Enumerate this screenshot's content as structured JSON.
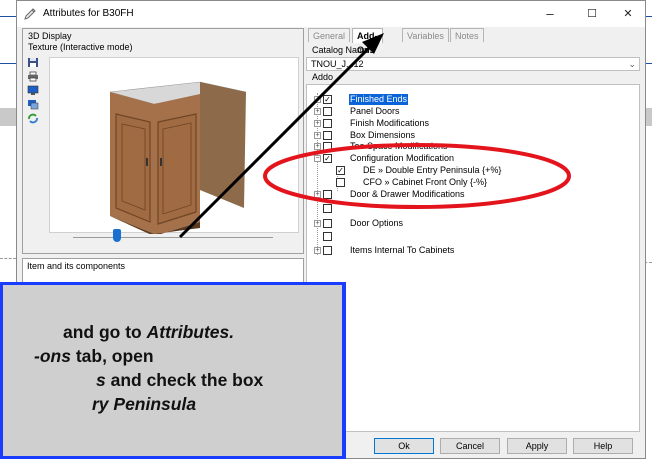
{
  "window": {
    "title": "Attributes for B30FH",
    "controls": {
      "minimize": "–",
      "maximize": "☐",
      "close": "✕"
    }
  },
  "left_panel": {
    "title": "3D Display",
    "subtitle": "Texture (Interactive mode)",
    "toolbar_icons": [
      "save-icon",
      "print-icon",
      "monitor-icon",
      "display-settings-icon",
      "refresh-icon"
    ],
    "components_title": "Item and its components"
  },
  "tabs": [
    {
      "label": "General",
      "active": false
    },
    {
      "label": "Add-Ons",
      "active": true
    },
    {
      "label": "Variables",
      "active": false
    },
    {
      "label": "Notes",
      "active": false
    }
  ],
  "catalog": {
    "label": "Catalog Name :",
    "value": "TNOU_J...12"
  },
  "addons_label": "Addo",
  "tree": [
    {
      "label": "Finished Ends",
      "checked": true,
      "expander": "+",
      "selected": true
    },
    {
      "label": "Panel Doors",
      "checked": false,
      "expander": "+"
    },
    {
      "label": "Finish Modifications",
      "checked": false,
      "expander": "+"
    },
    {
      "label": "Box Dimensions",
      "checked": false,
      "expander": "+"
    },
    {
      "label": "Toe Space Modifications",
      "checked": false,
      "expander": "+"
    },
    {
      "label": "Configuration Modification",
      "checked": true,
      "expander": "−"
    },
    {
      "label": "DE » Double Entry Peninsula {+%}",
      "checked": true,
      "child": true
    },
    {
      "label": "CFO » Cabinet Front Only {-%}",
      "checked": false,
      "child": true
    },
    {
      "label": "Door & Drawer Modifications",
      "checked": false,
      "expander": "+"
    },
    {
      "label": "Door Options",
      "checked": false,
      "expander": "+"
    },
    {
      "label": "Items Internal To Cabinets",
      "checked": false,
      "expander": "+"
    }
  ],
  "buttons": {
    "ok": "Ok",
    "cancel": "Cancel",
    "apply": "Apply",
    "help": "Help"
  },
  "callout": {
    "line1_plain": "and go to ",
    "line1_italic": "Attributes.",
    "line2_italic": "-ons",
    "line2_plain": " tab, open",
    "line3_italic": "s",
    "line3_plain": " and check the box",
    "line4_italic": "ry Peninsula"
  },
  "colors": {
    "selection": "#0a64d8",
    "callout_border": "#1a3cff",
    "annotation_ellipse": "#e3141b",
    "arrow": "#000000",
    "slider_thumb": "#1a6fd0"
  }
}
